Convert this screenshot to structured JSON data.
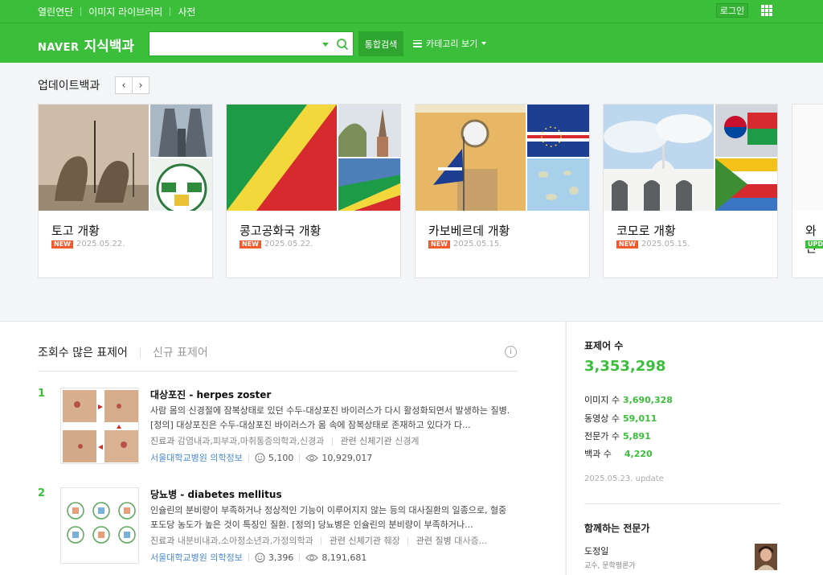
{
  "topbar": {
    "links": [
      "열린연단",
      "이미지 라이브러리",
      "사전"
    ],
    "login_label": "로그인"
  },
  "header": {
    "logo_naver": "NAVER",
    "logo_title": "지식백과",
    "search_value": "",
    "search_button": "통합검색",
    "category_button": "카테고리 보기"
  },
  "update": {
    "title": "업데이트백과",
    "prev": "‹",
    "next": "›",
    "cards": [
      {
        "title": "토고 개황",
        "badge": "NEW",
        "date": "2025.05.22."
      },
      {
        "title": "콩고공화국 개황",
        "badge": "NEW",
        "date": "2025.05.22."
      },
      {
        "title": "카보베르데 개황",
        "badge": "NEW",
        "date": "2025.05.15."
      },
      {
        "title": "코모로 개황",
        "badge": "NEW",
        "date": "2025.05.15."
      },
      {
        "title": "와인",
        "badge": "UPD",
        "date": ""
      }
    ]
  },
  "popular": {
    "tab_active": "조회수 많은 표제어",
    "tab_inactive": "신규 표제어",
    "info": "i",
    "entries": [
      {
        "rank": "1",
        "title": "대상포진 - herpes zoster",
        "desc": "사람 몸의 신경절에 잠복상태로 있던 수두-대상포진 바이러스가 다시 활성화되면서 발생하는 질병. [정의] 대상포진은 수두-대상포진 바이러스가 몸 속에 잠복상태로 존재하고 있다가 다...",
        "meta_label1": "진료과",
        "meta_value1": "감염내과,피부과,마취통증의학과,신경과",
        "meta_label2": "관련 신체기관",
        "meta_value2": "신경계",
        "meta_label3": "",
        "meta_value3": "",
        "source": "서울대학교병원 의학정보",
        "likes": "5,100",
        "views": "10,929,017"
      },
      {
        "rank": "2",
        "title": "당뇨병 - diabetes mellitus",
        "desc": "인슐린의 분비량이 부족하거나 정상적인 기능이 이루어지지 않는 등의 대사질환의 일종으로, 혈중 포도당 농도가 높은 것이 특징인 질환. [정의] 당뇨병은 인슐린의 분비량이 부족하거나...",
        "meta_label1": "진료과",
        "meta_value1": "내분비내과,소아청소년과,가정의학과",
        "meta_label2": "관련 신체기관",
        "meta_value2": "췌장",
        "meta_label3": "관련 질병",
        "meta_value3": "대사증...",
        "source": "서울대학교병원 의학정보",
        "likes": "3,396",
        "views": "8,191,681"
      }
    ]
  },
  "side": {
    "title": "표제어 수",
    "total": "3,353,298",
    "stats": [
      {
        "label": "이미지 수",
        "value": "3,690,328"
      },
      {
        "label": "동영상 수",
        "value": "59,011"
      },
      {
        "label": "전문가 수",
        "value": "5,891"
      },
      {
        "label": "백과 수",
        "value": "4,220"
      }
    ],
    "updated": "2025.05.23. update",
    "experts_title": "함께하는 전문가",
    "expert_name": "도정일",
    "expert_role": "교수, 문학평론가"
  },
  "colors": {
    "brand_green": "#3bbf3b",
    "new_badge": "#f05a2e",
    "link_blue": "#4b8bd0"
  }
}
